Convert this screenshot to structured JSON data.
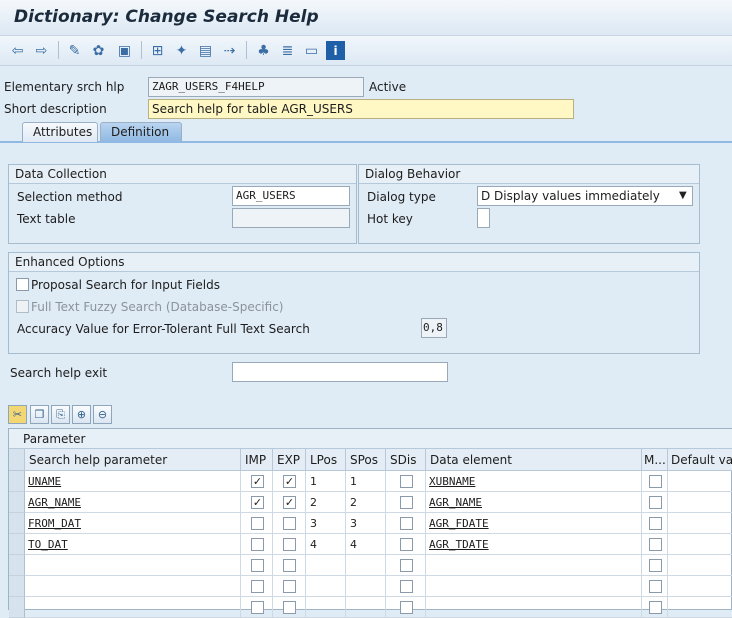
{
  "window": {
    "title": "Dictionary: Change Search Help"
  },
  "toolbar": {
    "icons": [
      "back-arrow",
      "forward-arrow",
      "display-change",
      "active-inactive",
      "where-used",
      "hierarchy",
      "activate",
      "object-list",
      "navigate",
      "tree",
      "more",
      "layout",
      "info"
    ]
  },
  "header": {
    "elementary_label": "Elementary srch hlp",
    "elementary_value": "ZAGR_USERS_F4HELP",
    "status": "Active",
    "short_desc_label": "Short description",
    "short_desc_value": "Search help for table AGR_USERS"
  },
  "tabs": [
    "Attributes",
    "Definition"
  ],
  "data_collection": {
    "title": "Data Collection",
    "selection_method_label": "Selection method",
    "selection_method_value": "AGR_USERS",
    "text_table_label": "Text table",
    "text_table_value": ""
  },
  "dialog_behavior": {
    "title": "Dialog Behavior",
    "dialog_type_label": "Dialog type",
    "dialog_type_value": "D Display values immediately",
    "hot_key_label": "Hot key",
    "hot_key_value": ""
  },
  "enhanced": {
    "title": "Enhanced Options",
    "proposal_label": "Proposal Search for Input Fields",
    "fulltext_label": "Full Text Fuzzy Search (Database-Specific)",
    "accuracy_label": "Accuracy Value for Error-Tolerant Full Text Search",
    "accuracy_value": "0,8"
  },
  "exit": {
    "label": "Search help exit",
    "value": ""
  },
  "table": {
    "title": "Parameter",
    "columns": [
      "Search help parameter",
      "IMP",
      "EXP",
      "LPos",
      "SPos",
      "SDis",
      "Data element",
      "M...",
      "Default value"
    ],
    "rows": [
      {
        "param": "UNAME",
        "imp": true,
        "exp": true,
        "lpos": "1",
        "spos": "1",
        "sdis": false,
        "element": "XUBNAME",
        "m": false
      },
      {
        "param": "AGR_NAME",
        "imp": true,
        "exp": true,
        "lpos": "2",
        "spos": "2",
        "sdis": false,
        "element": "AGR_NAME",
        "m": false
      },
      {
        "param": "FROM_DAT",
        "imp": false,
        "exp": false,
        "lpos": "3",
        "spos": "3",
        "sdis": false,
        "element": "AGR_FDATE",
        "m": false
      },
      {
        "param": "TO_DAT",
        "imp": false,
        "exp": false,
        "lpos": "4",
        "spos": "4",
        "sdis": false,
        "element": "AGR_TDATE",
        "m": false
      }
    ]
  }
}
